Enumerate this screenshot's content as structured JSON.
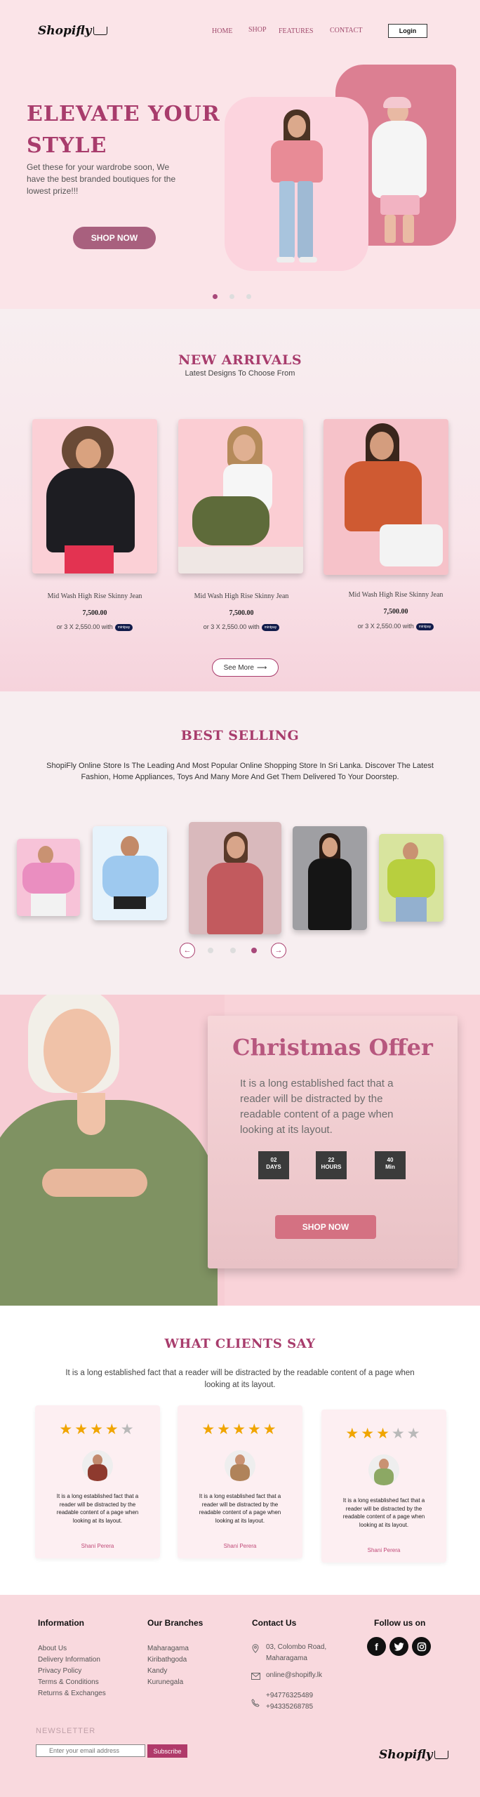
{
  "header": {
    "logo": "Shopifly",
    "nav": [
      "HOME",
      "SHOP",
      "FEATURES",
      "CONTACT"
    ],
    "login_label": "Login"
  },
  "hero": {
    "title_line1": "ELEVATE YOUR",
    "title_line2": "STYLE",
    "subtitle": "Get these for your wardrobe soon, We have the best branded boutiques for the lowest prize!!!",
    "cta": "SHOP NOW",
    "slide_count": 3,
    "active_slide": 1
  },
  "arrivals": {
    "title": "NEW ARRIVALS",
    "subtitle": "Latest Designs To Choose From",
    "products": [
      {
        "name": "Mid Wash High Rise Skinny Jean",
        "price": "7,500.00",
        "installment": "or 3 X 2,550.00 with",
        "badge": "mintpay"
      },
      {
        "name": "Mid Wash High Rise Skinny Jean",
        "price": "7,500.00",
        "installment": "or 3 X 2,550.00 with",
        "badge": "mintpay"
      },
      {
        "name": "Mid Wash High Rise Skinny Jean",
        "price": "7,500.00",
        "installment": "or 3 X 2,550.00 with",
        "badge": "mintpay"
      }
    ],
    "see_more": "See More"
  },
  "best": {
    "title": "BEST SELLING",
    "text": "ShopiFly Online Store Is The Leading And Most Popular Online Shopping Store In Sri Lanka. Discover The Latest Fashion, Home Appliances, Toys And Many More And Get Them Delivered To Your Doorstep.",
    "prev_icon": "arrow-left-icon",
    "next_icon": "arrow-right-icon",
    "active_dot": 3
  },
  "christmas": {
    "title": "Christmas Offer",
    "text": "It is a long established fact that a reader will be distracted by the readable content of a page when looking at its layout.",
    "timer": [
      {
        "value": "02",
        "unit": "DAYS"
      },
      {
        "value": "22",
        "unit": "HOURS"
      },
      {
        "value": "40",
        "unit": "Min"
      }
    ],
    "cta": "SHOP NOW"
  },
  "clients": {
    "title": "WHAT CLIENTS SAY",
    "text": "It is a long established fact that a reader will be distracted by the readable content of a page when looking at its layout.",
    "reviews": [
      {
        "rating": 4,
        "text": "It is a long established fact that a reader will be distracted by the readable content of a page when looking at its layout.",
        "name": "Shani Perera"
      },
      {
        "rating": 5,
        "text": "It is a long established fact that a reader will be distracted by the readable content of a page when looking at its layout.",
        "name": "Shani Perera"
      },
      {
        "rating": 3,
        "text": "It is a long established fact that a reader will be distracted by the readable content of a page when looking at its layout.",
        "name": "Shani Perera"
      }
    ]
  },
  "footer": {
    "info_title": "Information",
    "info_links": [
      "About Us",
      "Delivery Information",
      "Privacy Policy",
      "Terms & Conditions",
      "Returns & Exchanges"
    ],
    "branches_title": "Our Branches",
    "branches": [
      "Maharagama",
      "Kiribathgoda",
      "Kandy",
      "Kurunegala"
    ],
    "contact_title": "Contact Us",
    "address": "03, Colombo Road, Maharagama",
    "email": "online@shopifly.lk",
    "phone1": "+94776325489",
    "phone2": "+94335268785",
    "follow_title": "Follow us on",
    "social_icons": [
      "facebook-icon",
      "twitter-icon",
      "instagram-icon"
    ],
    "newsletter_label": "NEWSLETTER",
    "newsletter_placeholder": "Enter your email address",
    "subscribe_label": "Subscribe",
    "logo": "Shopifly"
  },
  "colors": {
    "accent": "#a83c6c",
    "hero_bg": "#fbe4e8",
    "cta": "#a8607e",
    "star": "#f0a500"
  }
}
